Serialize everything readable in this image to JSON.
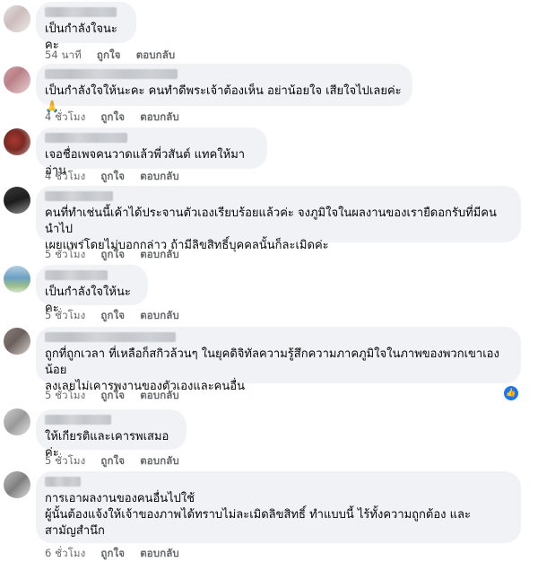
{
  "actions": {
    "like_label": "ถูกใจ",
    "reply_label": "ตอบกลับ"
  },
  "colors": {
    "bubble": "#f0f2f5",
    "meta": "#65676b",
    "like_icon": "#1877f2"
  },
  "comments": [
    {
      "text": "เป็นกำลังใจนะคะ",
      "time": "54 นาที"
    },
    {
      "text": "เป็นกำลังใจให้นะคะ คนทำดีพระเจ้าต้องเห็น อย่าน้อยใจ เสียใจไปเลยค่ะ🙏",
      "time": "4 ชั่วโมง"
    },
    {
      "text": "เจอชื่อเพจคนวาดแล้วพี่วสันต์ แทคให้มาอ่าน",
      "time": "4 ชั่วโมง"
    },
    {
      "text": "คนที่ทำเช่นนี้เค้าได้ประจานตัวเองเรียบร้อยแล้วค่ะ จงภูมิใจในผลงานของเรายืดอกรับที่มีคนนำไป\nเผยแพร่โดยไม่บอกกล่าว ถ้ามีลิขสิทธิ์บุคคลนั้นก็ละเมิดค่ะ",
      "time": "5 ชั่วโมง"
    },
    {
      "text": "เป็นกำลังใจให้นะคะ",
      "time": "5 ชั่วโมง"
    },
    {
      "text": "ถูกที่ถูกเวลา ที่เหลือก็สกิวล้วนๆ ในยุคดิจิทัลความรู้สึกความภาคภูมิใจในภาพของพวกเขาเองน้อย\nลงเลยไม่เคารพงานของตัวเองและคนอื่น",
      "time": "5 ชั่วโมง",
      "liked_icon": "thumbs-up-icon"
    },
    {
      "text": "ให้เกียรติและเคารพเสมอค่ะ",
      "time": "5 ชั่วโมง"
    },
    {
      "text": "การเอาผลงานของคนอื่นไปใช้\nผู้นั้นต้องแจ้งให้เจ้าของภาพได้ทราบไม่ละเมิดลิขสิทธิ์ ทำแบบนี้ ไร้ทั้งความถูกต้อง และ\nสามัญสำนึก",
      "time": "6 ชั่วโมง"
    }
  ]
}
